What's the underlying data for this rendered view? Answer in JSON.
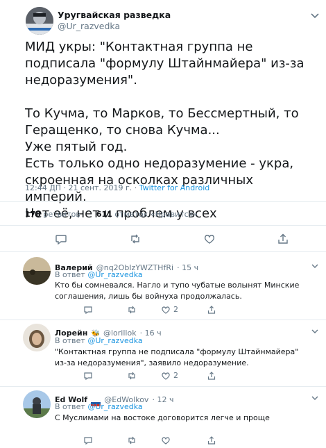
{
  "tweet": {
    "author_name": "Уругвайская разведка",
    "author_handle": "@Ur_razvedka",
    "text": "МИД укры: \"Контактная группа не подписала \"формулу Штайнмайера\" из-за недоразумения\".\n\nТо Кучма, то Марков, то Бессмертный, то Геращенко, то снова Кучма...\nУже пятый год.\nЕсть только одно недоразумение - укра, скроенная на осколках различных империй.\nНет её, нет и проблем у всех",
    "timestamp": "12:44 ДП · 21 сент. 2019 г. · ",
    "source": "Twitter for Android",
    "retweets_count": "178",
    "retweets_label": "ретвитов",
    "likes_count": "611",
    "likes_label": "отметок «Нравится»"
  },
  "replies": [
    {
      "name": "Валерий",
      "handle": "@nq2ObIzYWZTHfRi",
      "time": "· 15 ч",
      "reply_prefix": "В ответ",
      "reply_to": "@Ur_razvedka",
      "text": "Кто бы сомневался. Нагло и тупо чубатые волынят Минские соглашения, лишь бы войнуха продолжалась.",
      "likes": "2"
    },
    {
      "name": "Лорейн",
      "handle": "@lorillok",
      "time": "· 16 ч",
      "reply_prefix": "В ответ",
      "reply_to": "@Ur_razvedka",
      "text": "\"Контактная группа не подписала \"формулу Штайнмайера\" из-за недоразумения\", заявило недоразумение.",
      "likes": "2"
    },
    {
      "name": "Ed Wolf",
      "handle": "@EdWolkov",
      "time": "· 12 ч",
      "reply_prefix": "В ответ",
      "reply_to": "@Ur_razvedka",
      "text": "С Муслимами на востоке договорится легче и проще",
      "likes": ""
    }
  ],
  "colors": {
    "link": "#1b95e0",
    "muted": "#657786",
    "text": "#14171a",
    "divider": "#e6ecf0"
  }
}
